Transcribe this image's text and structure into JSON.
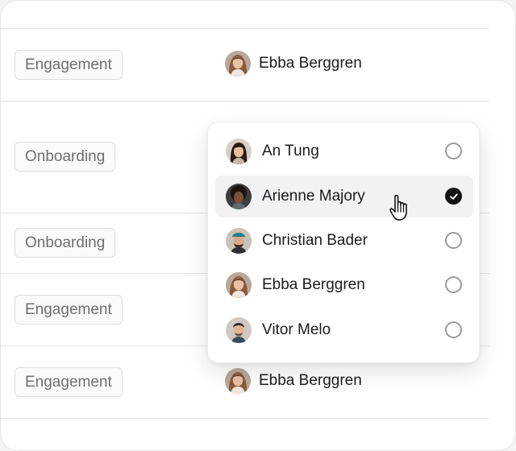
{
  "rows": [
    {
      "tag": "Engagement",
      "assignee": "Ebba Berggren"
    },
    {
      "tag": "Onboarding",
      "assignee": ""
    },
    {
      "tag": "Onboarding",
      "assignee": ""
    },
    {
      "tag": "Engagement",
      "assignee": ""
    },
    {
      "tag": "Engagement",
      "assignee": "Ebba Berggren"
    }
  ],
  "dropdown": {
    "options": [
      {
        "name": "An Tung",
        "selected": false,
        "avatar": "avatar-an-tung"
      },
      {
        "name": "Arienne Majory",
        "selected": true,
        "avatar": "avatar-arienne-majory"
      },
      {
        "name": "Christian Bader",
        "selected": false,
        "avatar": "avatar-christian-bader"
      },
      {
        "name": "Ebba Berggren",
        "selected": false,
        "avatar": "avatar-ebba-berggren"
      },
      {
        "name": "Vitor Melo",
        "selected": false,
        "avatar": "avatar-vitor-melo"
      }
    ]
  },
  "icons": {
    "check": "checkmark-icon",
    "cursor": "pointer-hand-icon"
  },
  "colors": {
    "checked_fill": "#141416",
    "tag_text": "#6e6e73",
    "selected_row_bg": "#f2f2f4"
  }
}
